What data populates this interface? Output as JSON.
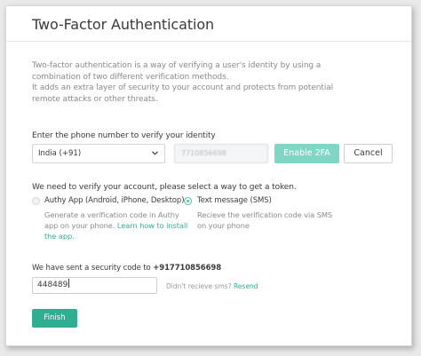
{
  "page": {
    "title": "Two-Factor Authentication",
    "description": [
      "Two-factor authentication is a way of verifying a user's identity by using a",
      "combination of two different verification methods.",
      "It adds an extra layer of security to your account and protects from potential",
      "remote attacks or other threats."
    ]
  },
  "phone": {
    "label": "Enter the phone number to verify your identity",
    "country_selected": "India (+91)",
    "number_value": "7710856698",
    "enable_label": "Enable 2FA",
    "cancel_label": "Cancel"
  },
  "verify": {
    "label": "We need to verify your account, please select a way to get a token.",
    "options": [
      {
        "label": "Authy App (Android, iPhone, Desktop)",
        "selected": false,
        "desc_line1": "Generate a verification code in Authy",
        "desc_line2_prefix": "app on your phone. ",
        "link_part1": "Learn how to install",
        "link_part2": "the app."
      },
      {
        "label": "Text message (SMS)",
        "selected": true,
        "desc_line1": "Recieve the verification code via SMS",
        "desc_line2": "on your phone"
      }
    ]
  },
  "security": {
    "sent_prefix": "We have sent a security code to ",
    "sent_number": "+917710856698",
    "code_value": "448489",
    "resend_prefix": "Didn't recieve sms? ",
    "resend_link": "Resend"
  },
  "actions": {
    "finish_label": "Finish"
  },
  "colors": {
    "accent": "#2fae92",
    "accent_disabled": "#7fd6c4"
  }
}
